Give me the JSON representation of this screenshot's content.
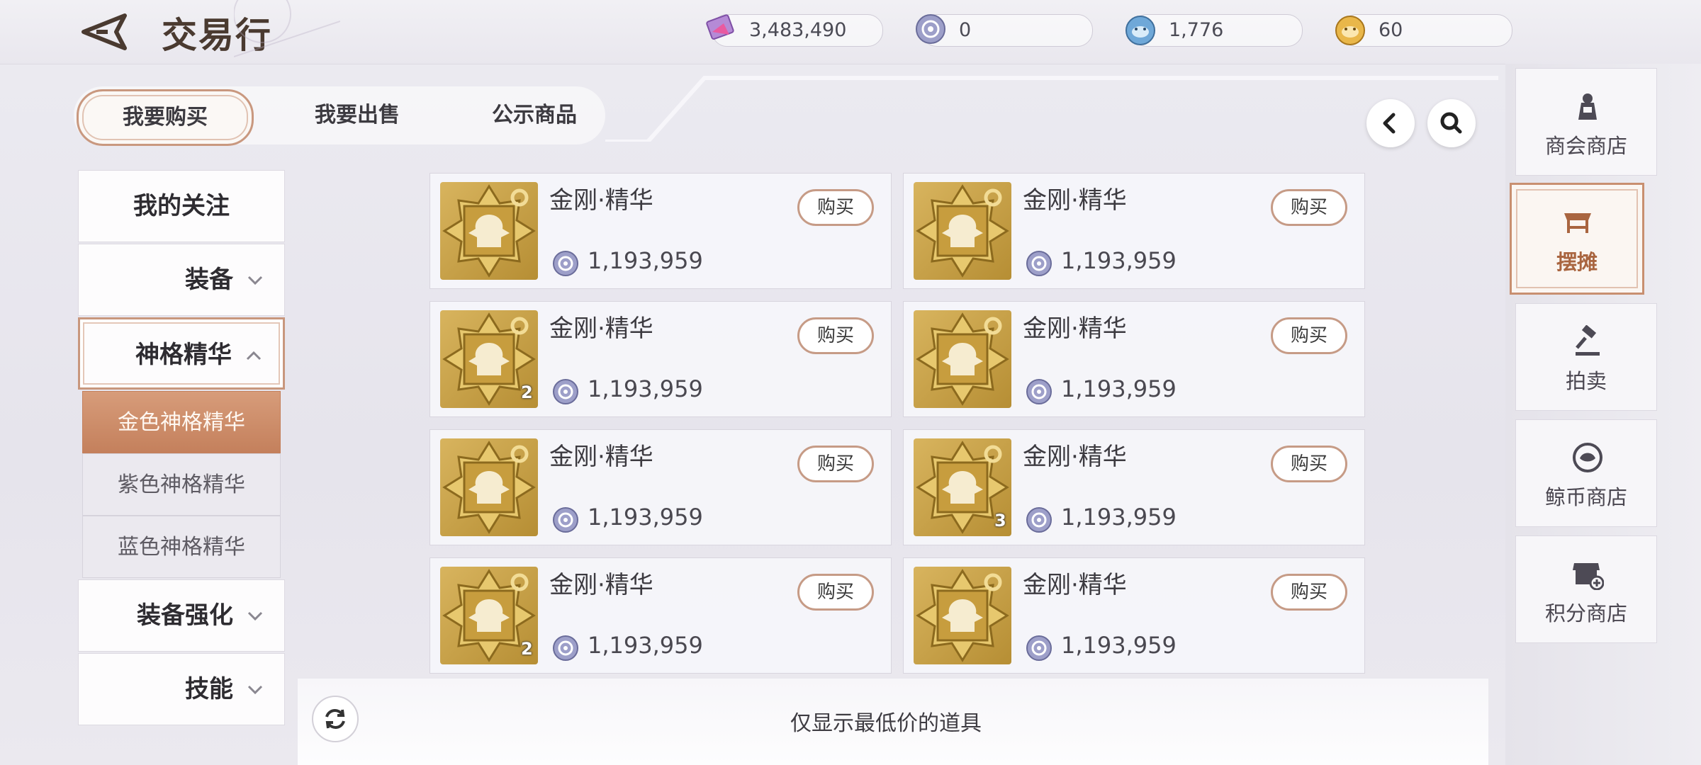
{
  "header": {
    "title": "交易行",
    "currencies": [
      {
        "icon": "crystal-card-icon",
        "value": "3,483,490"
      },
      {
        "icon": "silver-coin-icon",
        "value": "0"
      },
      {
        "icon": "blue-whale-coin-icon",
        "value": "1,776"
      },
      {
        "icon": "gold-whale-coin-icon",
        "value": "60"
      }
    ]
  },
  "tabs": {
    "buy": "我要购买",
    "sell": "我要出售",
    "public": "公示商品"
  },
  "sidebar": {
    "favorites": "我的关注",
    "equipment": "装备",
    "essence": "神格精华",
    "sub": {
      "gold": "金色神格精华",
      "purple": "紫色神格精华",
      "blue": "蓝色神格精华"
    },
    "enhance": "装备强化",
    "skill": "技能"
  },
  "items": [
    {
      "name": "金刚·精华",
      "price": "1,193,959",
      "qty": "",
      "buy": "购买"
    },
    {
      "name": "金刚·精华",
      "price": "1,193,959",
      "qty": "",
      "buy": "购买"
    },
    {
      "name": "金刚·精华",
      "price": "1,193,959",
      "qty": "2",
      "buy": "购买"
    },
    {
      "name": "金刚·精华",
      "price": "1,193,959",
      "qty": "",
      "buy": "购买"
    },
    {
      "name": "金刚·精华",
      "price": "1,193,959",
      "qty": "",
      "buy": "购买"
    },
    {
      "name": "金刚·精华",
      "price": "1,193,959",
      "qty": "3",
      "buy": "购买"
    },
    {
      "name": "金刚·精华",
      "price": "1,193,959",
      "qty": "2",
      "buy": "购买"
    },
    {
      "name": "金刚·精华",
      "price": "1,193,959",
      "qty": "",
      "buy": "购买"
    }
  ],
  "footer": {
    "filter_text": "仅显示最低价的道具"
  },
  "rightnav": {
    "guild": "商会商店",
    "stall": "摆摊",
    "auction": "拍卖",
    "whale": "鲸币商店",
    "points": "积分商店"
  },
  "colors": {
    "accent": "#c4805c",
    "gold": "#d8b45e"
  }
}
